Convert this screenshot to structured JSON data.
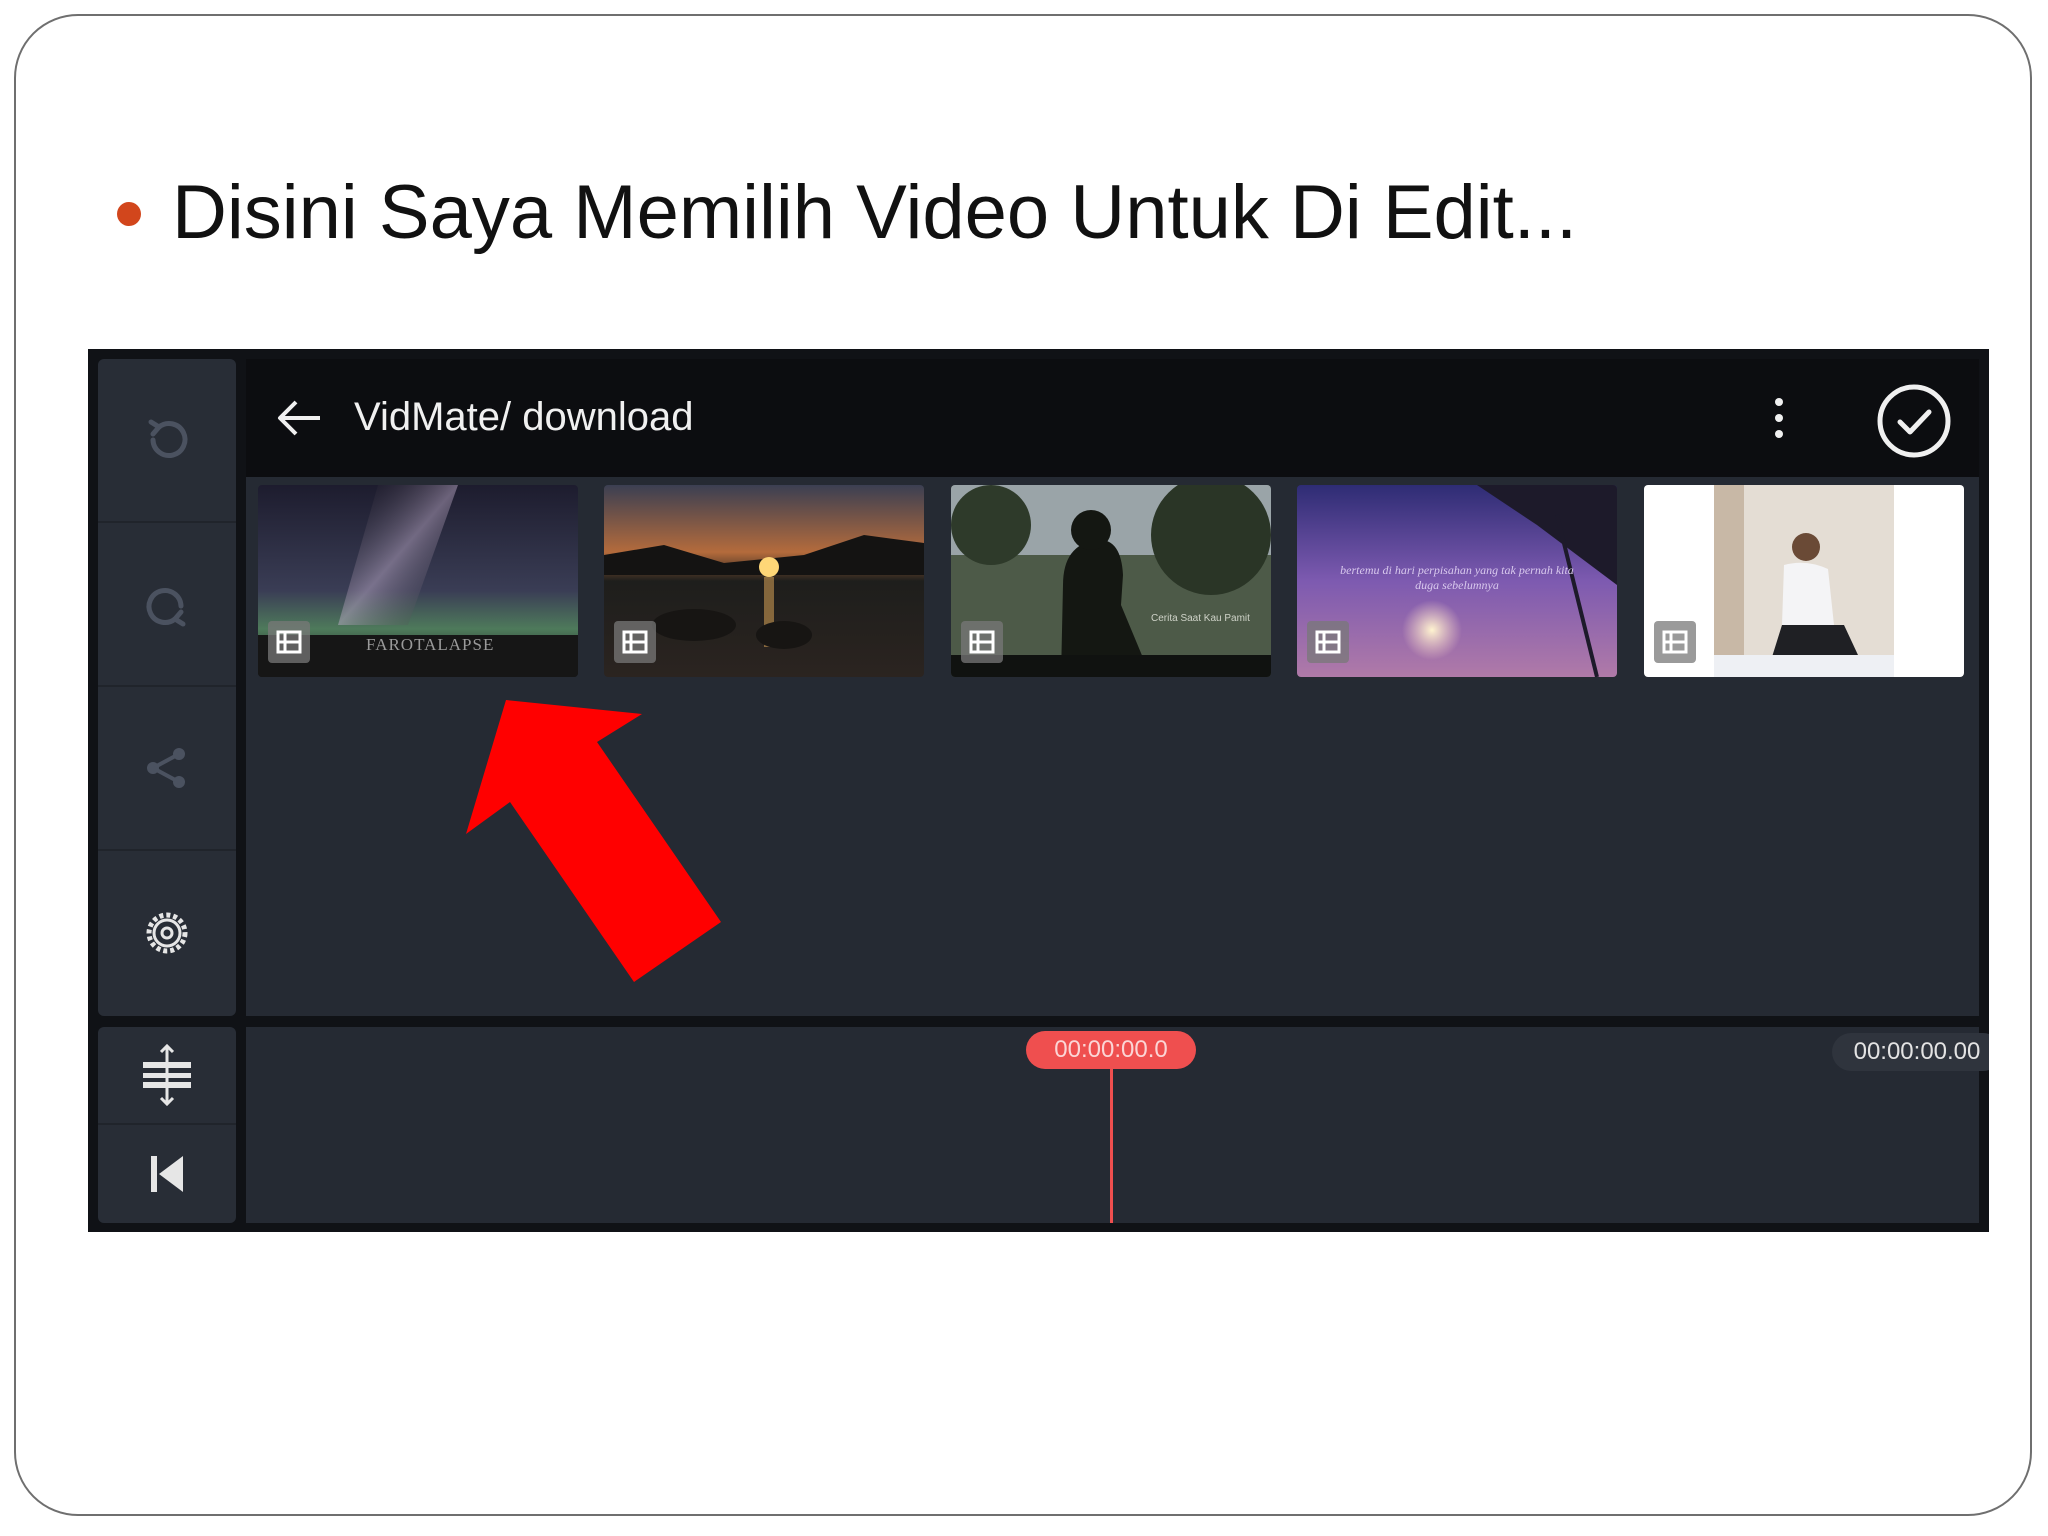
{
  "slide": {
    "title": "Disini Saya Memilih Video Untuk Di Edit...",
    "bullet_color": "#d2461c"
  },
  "app": {
    "folder_path": "VidMate/ download",
    "side_panel": {
      "items": [
        {
          "name": "undo",
          "icon": "undo-icon"
        },
        {
          "name": "redo",
          "icon": "redo-icon"
        },
        {
          "name": "share",
          "icon": "share-icon"
        },
        {
          "name": "settings",
          "icon": "gear-icon"
        }
      ],
      "bottom_items": [
        {
          "name": "split",
          "icon": "split-track-icon"
        },
        {
          "name": "jump-to-start",
          "icon": "skip-to-start-icon"
        }
      ]
    },
    "thumbnails": [
      {
        "name": "milky-way",
        "caption": "FAROTALAPSE"
      },
      {
        "name": "sunset-lake",
        "caption": ""
      },
      {
        "name": "silhouette-forest",
        "caption": "Cerita Saat Kau Pamit"
      },
      {
        "name": "purple-sky",
        "caption": "bertemu di hari perpisahan yang tak pernah kita duga sebelumnya"
      },
      {
        "name": "man-sitting",
        "caption": ""
      }
    ],
    "timeline": {
      "playhead_time": "00:00:00.0",
      "total_time": "00:00:00.00"
    },
    "colors": {
      "accent": "#ef4f4f",
      "toolbar": "#0c0d10",
      "panel": "#252a33",
      "arrow": "#ff0000"
    }
  }
}
